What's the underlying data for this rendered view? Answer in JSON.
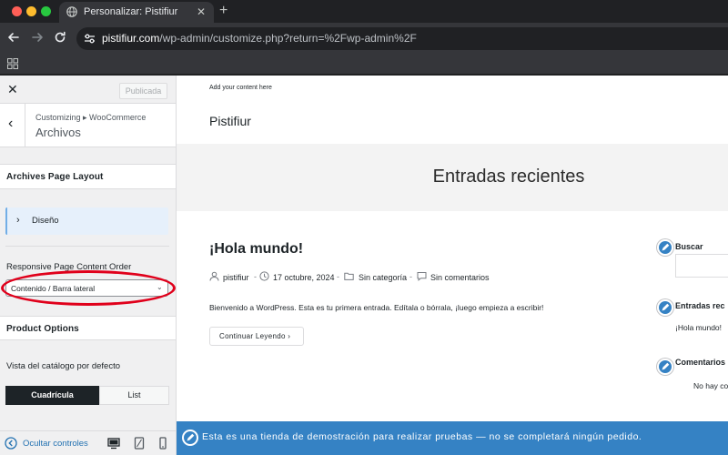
{
  "browser": {
    "tab_title": "Personalizar: Pistifiur",
    "url_host": "pistifiur.com",
    "url_path": "/wp-admin/customize.php?return=%2Fwp-admin%2F"
  },
  "customizer": {
    "publish_label": "Publicada",
    "breadcrumb": "Customizing ▸ WooCommerce",
    "section_name": "Archivos",
    "archives_layout_heading": "Archives Page Layout",
    "design_label": "Diseño",
    "responsive_label": "Responsive Page Content Order",
    "responsive_value": "Contenido / Barra lateral",
    "product_options_heading": "Product Options",
    "catalog_view_label": "Vista del catálogo por defecto",
    "catalog_options": [
      "Cuadrícula",
      "List"
    ],
    "catalog_selected": "Cuadrícula",
    "hide_controls_label": "Ocultar controles",
    "preview_device_selected": "desktop"
  },
  "preview": {
    "topbar_text": "Add your content here",
    "site_title": "Pistifiur",
    "hero_title": "Entradas recientes",
    "post": {
      "title": "¡Hola mundo!",
      "author": "pistifiur",
      "date": "17 octubre, 2024",
      "category": "Sin categoría",
      "comments": "Sin comentarios",
      "excerpt": "Bienvenido a WordPress. Esta es tu primera entrada. Edítala o bórrala, ¡luego empieza a escribir!",
      "read_more": "Continuar Leyendo ›"
    },
    "sidebar": {
      "search_title": "Buscar",
      "recent_title": "Entradas rec",
      "recent_item": "¡Hola mundo!",
      "comments_title": "Comentarios",
      "comments_text": "No hay co"
    },
    "store_notice": "Esta es una tienda de demostración para realizar pruebas — no se completará ningún pedido."
  },
  "colors": {
    "accent": "#2271b1",
    "notice_bg": "#3582c4",
    "annotation_oval": "#e0001b"
  }
}
